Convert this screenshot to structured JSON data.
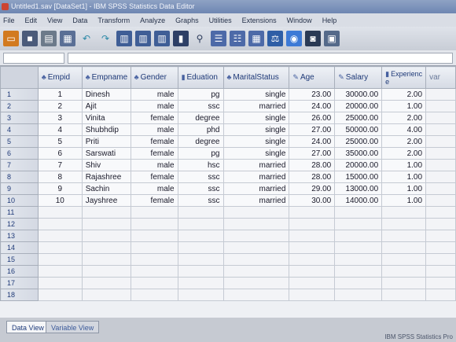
{
  "window": {
    "title": "Untitled1.sav [DataSet1] - IBM SPSS Statistics Data Editor"
  },
  "menu": [
    "File",
    "Edit",
    "View",
    "Data",
    "Transform",
    "Analyze",
    "Graphs",
    "Utilities",
    "Extensions",
    "Window",
    "Help"
  ],
  "toolbar": {
    "icons": [
      "open-icon",
      "save-icon",
      "print-icon",
      "dialog-recall-icon",
      "undo-icon",
      "redo-icon",
      "goto-case-icon",
      "goto-variable-icon",
      "variables-icon",
      "run-descriptives-icon",
      "find-icon",
      "insert-cases-icon",
      "insert-variable-icon",
      "split-file-icon",
      "weight-cases-icon",
      "select-cases-icon",
      "value-labels-icon",
      "use-sets-icon"
    ]
  },
  "columns": [
    {
      "name": "Empid",
      "icon": "nominal-icon"
    },
    {
      "name": "Empname",
      "icon": "nominal-icon"
    },
    {
      "name": "Gender",
      "icon": "nominal-icon"
    },
    {
      "name": "Eduation",
      "icon": "ordinal-icon"
    },
    {
      "name": "MaritalStatus",
      "icon": "nominal-icon"
    },
    {
      "name": "Age",
      "icon": "scale-icon"
    },
    {
      "name": "Salary",
      "icon": "scale-icon"
    },
    {
      "name": "Experienc e",
      "icon": "ordinal-icon"
    },
    {
      "name": "var",
      "icon": ""
    }
  ],
  "rows": [
    [
      "1",
      "Dinesh",
      "male",
      "pg",
      "single",
      "23.00",
      "30000.00",
      "2.00"
    ],
    [
      "2",
      "Ajit",
      "male",
      "ssc",
      "married",
      "24.00",
      "20000.00",
      "1.00"
    ],
    [
      "3",
      "Vinita",
      "female",
      "degree",
      "single",
      "26.00",
      "25000.00",
      "2.00"
    ],
    [
      "4",
      "Shubhdip",
      "male",
      "phd",
      "single",
      "27.00",
      "50000.00",
      "4.00"
    ],
    [
      "5",
      "Priti",
      "female",
      "degree",
      "single",
      "24.00",
      "25000.00",
      "2.00"
    ],
    [
      "6",
      "Sarswati",
      "female",
      "pg",
      "single",
      "27.00",
      "35000.00",
      "2.00"
    ],
    [
      "7",
      "Shiv",
      "male",
      "hsc",
      "married",
      "28.00",
      "20000.00",
      "1.00"
    ],
    [
      "8",
      "Rajashree",
      "female",
      "ssc",
      "married",
      "28.00",
      "15000.00",
      "1.00"
    ],
    [
      "9",
      "Sachin",
      "male",
      "ssc",
      "married",
      "29.00",
      "13000.00",
      "1.00"
    ],
    [
      "10",
      "Jayshree",
      "female",
      "ssc",
      "married",
      "30.00",
      "14000.00",
      "1.00"
    ]
  ],
  "row_numbers": [
    "1",
    "2",
    "3",
    "4",
    "5",
    "6",
    "7",
    "8",
    "9",
    "10",
    "11",
    "12",
    "13",
    "14",
    "15",
    "16",
    "17",
    "18"
  ],
  "tabs": {
    "data_view": "Data View",
    "variable_view": "Variable View"
  },
  "status": "IBM SPSS Statistics Pro"
}
